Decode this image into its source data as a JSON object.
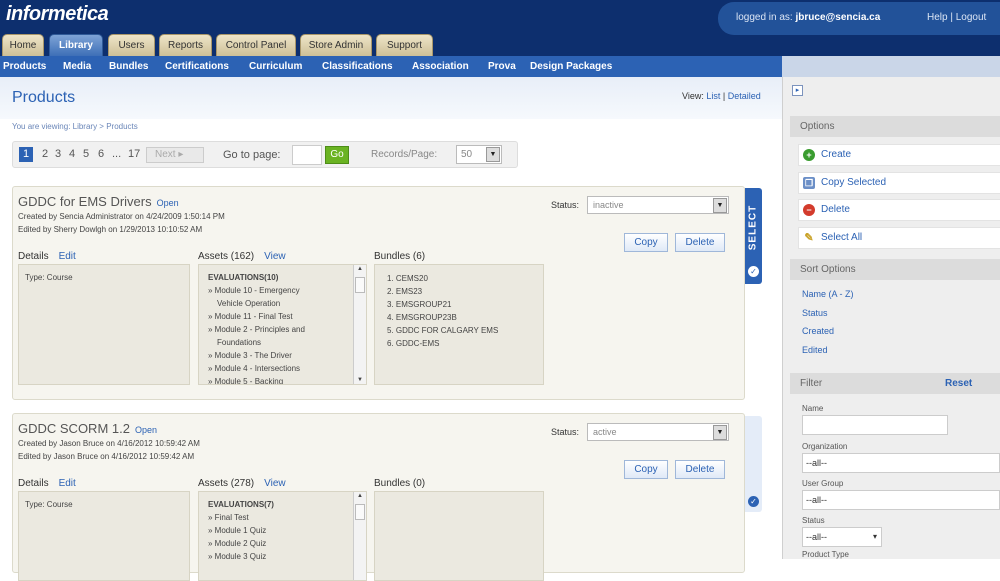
{
  "app": {
    "logo": "informetica"
  },
  "header": {
    "logged_in_label": "logged in as:",
    "user": "jbruce@sencia.ca",
    "help": "Help",
    "logout": "Logout"
  },
  "tabs": [
    "Home",
    "Library",
    "Users",
    "Reports",
    "Control Panel",
    "Store Admin",
    "Support"
  ],
  "subnav": [
    "Products",
    "Media",
    "Bundles",
    "Certifications",
    "Curriculum",
    "Classifications",
    "Association",
    "Prova",
    "Design Packages"
  ],
  "page": {
    "title": "Products",
    "view_label": "View:",
    "view_list": "List",
    "view_detailed": "Detailed",
    "breadcrumb": "You are viewing: Library > Products"
  },
  "pager": {
    "pages": [
      "1",
      "2",
      "3",
      "4",
      "5",
      "6",
      "...",
      "17"
    ],
    "next": "Next",
    "goto_label": "Go to page:",
    "go": "Go",
    "records_label": "Records/Page:",
    "records_value": "50"
  },
  "products": [
    {
      "title": "GDDC for EMS Drivers",
      "open": "Open",
      "created": "Created by Sencia  Administrator on 4/24/2009 1:50:14 PM",
      "edited": "Edited by Sherry Dowlgh on 1/29/2013 10:10:52 AM",
      "status_label": "Status:",
      "status": "inactive",
      "copy": "Copy",
      "delete": "Delete",
      "details_label": "Details",
      "details_edit": "Edit",
      "type": "Type: Course",
      "assets_label": "Assets (162)",
      "assets_view": "View",
      "assets": [
        "EVALUATIONS(10)",
        "» Module 10 - Emergency",
        "   Vehicle Operation",
        "» Module 11 - Final Test",
        "» Module 2 - Principles and",
        "   Foundations",
        "» Module 3 - The Driver",
        "» Module 4 - Intersections",
        "» Module 5 - Backing"
      ],
      "bundles_label": "Bundles (6)",
      "bundles": [
        "1.   CEMS20",
        "2.   EMS23",
        "3.   EMSGROUP21",
        "4.   EMSGROUP23B",
        "5.   GDDC FOR CALGARY EMS",
        "6.   GDDC-EMS"
      ]
    },
    {
      "title": "GDDC SCORM 1.2",
      "open": "Open",
      "created": "Created by Jason Bruce on 4/16/2012 10:59:42 AM",
      "edited": "Edited by Jason Bruce on 4/16/2012 10:59:42 AM",
      "status_label": "Status:",
      "status": "active",
      "copy": "Copy",
      "delete": "Delete",
      "details_label": "Details",
      "details_edit": "Edit",
      "type": "Type: Course",
      "assets_label": "Assets (278)",
      "assets_view": "View",
      "assets": [
        "EVALUATIONS(7)",
        "» Final Test",
        "» Module 1 Quiz",
        "» Module 2 Quiz",
        "» Module 3 Quiz"
      ],
      "bundles_label": "Bundles (0)",
      "bundles": []
    }
  ],
  "select_label": "SELECT",
  "sidebar": {
    "options_title": "Options",
    "options": [
      {
        "label": "Create",
        "icon": "plus-circle-icon",
        "color": "#3a9c2f"
      },
      {
        "label": "Copy Selected",
        "icon": "copy-icon",
        "color": "#6b8fc7"
      },
      {
        "label": "Delete",
        "icon": "minus-circle-icon",
        "color": "#d33b2c"
      },
      {
        "label": "Select All",
        "icon": "wand-icon",
        "color": "#c9a227"
      }
    ],
    "sort_title": "Sort Options",
    "sort": [
      "Name  (A - Z)",
      "Status",
      "Created",
      "Edited"
    ],
    "filter_title": "Filter",
    "filter_reset": "Reset",
    "filter_fields": [
      {
        "label": "Name",
        "value": ""
      },
      {
        "label": "Organization",
        "value": "--all--"
      },
      {
        "label": "User Group",
        "value": "--all--"
      },
      {
        "label": "Status",
        "value": "--all--"
      },
      {
        "label": "Product Type",
        "value": ""
      }
    ]
  }
}
